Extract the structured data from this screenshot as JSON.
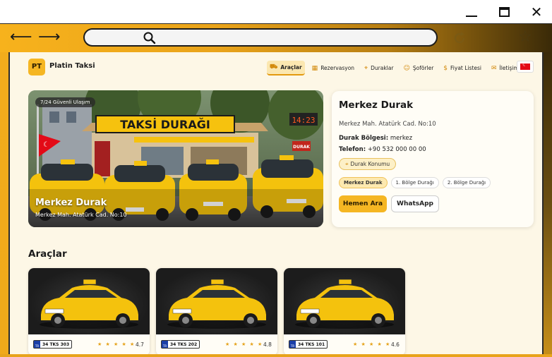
{
  "browser": {
    "minimize_icon": "minimize-icon",
    "maximize_icon": "maximize-icon",
    "close_icon": "close-icon",
    "back_icon": "arrow-left-icon",
    "forward_icon": "arrow-right-icon",
    "search_icon": "search-icon",
    "reload_icon": "reload-icon",
    "bookmark_icon": "star-icon",
    "url": ""
  },
  "header": {
    "logo_text": "PT",
    "brand": "Platin Taksi",
    "menu": [
      {
        "label": "Araçlar",
        "icon": "car-icon",
        "active": true
      },
      {
        "label": "Rezervasyon",
        "icon": "calendar-icon",
        "active": false
      },
      {
        "label": "Duraklar",
        "icon": "map-pin-icon",
        "active": false
      },
      {
        "label": "Şoförler",
        "icon": "user-icon",
        "active": false
      },
      {
        "label": "Fiyat Listesi",
        "icon": "price-icon",
        "active": false
      },
      {
        "label": "İletişim",
        "icon": "message-icon",
        "active": false
      }
    ],
    "language_flag": "turkey-flag-icon"
  },
  "hero": {
    "badge": "7/24 Güvenli Ulaşım",
    "sign": "TAKSİ DURAĞI",
    "clock": "14:23",
    "durak_sign": "DURAK",
    "title": "Merkez Durak",
    "address": "Merkez Mah. Atatürk Cad. No:10"
  },
  "info": {
    "title": "Merkez Durak",
    "address": "Merkez Mah. Atatürk Cad. No:10",
    "region_label": "Durak Bölgesi:",
    "region_value": "merkez",
    "phone_label": "Telefon:",
    "phone_value": "+90 532 000 00 00",
    "location_chip": "Durak Konumu",
    "stops": [
      {
        "label": "Merkez Durak",
        "active": true
      },
      {
        "label": "1. Bölge Durağı",
        "active": false
      },
      {
        "label": "2. Bölge Durağı",
        "active": false
      }
    ],
    "call_button": "Hemen Ara",
    "whatsapp_button": "WhatsApp"
  },
  "vehicles_section": {
    "title": "Araçlar",
    "vehicles": [
      {
        "plate": "34 TKS 303",
        "plate_country": "TR",
        "car_plate": "34 TCB 45",
        "stars": "★ ★ ★ ★ ★",
        "rating": "4.7"
      },
      {
        "plate": "34 TKS 202",
        "plate_country": "TR",
        "car_plate": "",
        "stars": "★ ★ ★ ★ ★",
        "rating": "4.8"
      },
      {
        "plate": "34 TKS 101",
        "plate_country": "TR",
        "car_plate": "",
        "stars": "★ ★ ★ ★ ★",
        "rating": "4.6"
      }
    ]
  },
  "colors": {
    "accent": "#f5b623",
    "page_bg": "#fdf7e6",
    "taxi_yellow": "#f4c20d"
  }
}
